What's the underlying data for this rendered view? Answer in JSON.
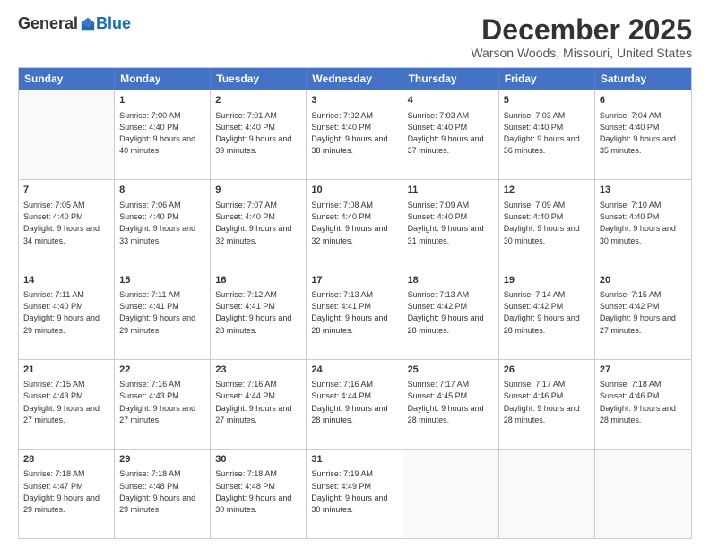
{
  "header": {
    "logo_general": "General",
    "logo_blue": "Blue",
    "month": "December 2025",
    "location": "Warson Woods, Missouri, United States"
  },
  "days_of_week": [
    "Sunday",
    "Monday",
    "Tuesday",
    "Wednesday",
    "Thursday",
    "Friday",
    "Saturday"
  ],
  "rows": [
    [
      {
        "day": "",
        "empty": true
      },
      {
        "day": "1",
        "rise": "7:00 AM",
        "set": "4:40 PM",
        "hours": "9 hours and 40 minutes."
      },
      {
        "day": "2",
        "rise": "7:01 AM",
        "set": "4:40 PM",
        "hours": "9 hours and 39 minutes."
      },
      {
        "day": "3",
        "rise": "7:02 AM",
        "set": "4:40 PM",
        "hours": "9 hours and 38 minutes."
      },
      {
        "day": "4",
        "rise": "7:03 AM",
        "set": "4:40 PM",
        "hours": "9 hours and 37 minutes."
      },
      {
        "day": "5",
        "rise": "7:03 AM",
        "set": "4:40 PM",
        "hours": "9 hours and 36 minutes."
      },
      {
        "day": "6",
        "rise": "7:04 AM",
        "set": "4:40 PM",
        "hours": "9 hours and 35 minutes."
      }
    ],
    [
      {
        "day": "7",
        "rise": "7:05 AM",
        "set": "4:40 PM",
        "hours": "9 hours and 34 minutes."
      },
      {
        "day": "8",
        "rise": "7:06 AM",
        "set": "4:40 PM",
        "hours": "9 hours and 33 minutes."
      },
      {
        "day": "9",
        "rise": "7:07 AM",
        "set": "4:40 PM",
        "hours": "9 hours and 32 minutes."
      },
      {
        "day": "10",
        "rise": "7:08 AM",
        "set": "4:40 PM",
        "hours": "9 hours and 32 minutes."
      },
      {
        "day": "11",
        "rise": "7:09 AM",
        "set": "4:40 PM",
        "hours": "9 hours and 31 minutes."
      },
      {
        "day": "12",
        "rise": "7:09 AM",
        "set": "4:40 PM",
        "hours": "9 hours and 30 minutes."
      },
      {
        "day": "13",
        "rise": "7:10 AM",
        "set": "4:40 PM",
        "hours": "9 hours and 30 minutes."
      }
    ],
    [
      {
        "day": "14",
        "rise": "7:11 AM",
        "set": "4:40 PM",
        "hours": "9 hours and 29 minutes."
      },
      {
        "day": "15",
        "rise": "7:11 AM",
        "set": "4:41 PM",
        "hours": "9 hours and 29 minutes."
      },
      {
        "day": "16",
        "rise": "7:12 AM",
        "set": "4:41 PM",
        "hours": "9 hours and 28 minutes."
      },
      {
        "day": "17",
        "rise": "7:13 AM",
        "set": "4:41 PM",
        "hours": "9 hours and 28 minutes."
      },
      {
        "day": "18",
        "rise": "7:13 AM",
        "set": "4:42 PM",
        "hours": "9 hours and 28 minutes."
      },
      {
        "day": "19",
        "rise": "7:14 AM",
        "set": "4:42 PM",
        "hours": "9 hours and 28 minutes."
      },
      {
        "day": "20",
        "rise": "7:15 AM",
        "set": "4:42 PM",
        "hours": "9 hours and 27 minutes."
      }
    ],
    [
      {
        "day": "21",
        "rise": "7:15 AM",
        "set": "4:43 PM",
        "hours": "9 hours and 27 minutes."
      },
      {
        "day": "22",
        "rise": "7:16 AM",
        "set": "4:43 PM",
        "hours": "9 hours and 27 minutes."
      },
      {
        "day": "23",
        "rise": "7:16 AM",
        "set": "4:44 PM",
        "hours": "9 hours and 27 minutes."
      },
      {
        "day": "24",
        "rise": "7:16 AM",
        "set": "4:44 PM",
        "hours": "9 hours and 28 minutes."
      },
      {
        "day": "25",
        "rise": "7:17 AM",
        "set": "4:45 PM",
        "hours": "9 hours and 28 minutes."
      },
      {
        "day": "26",
        "rise": "7:17 AM",
        "set": "4:46 PM",
        "hours": "9 hours and 28 minutes."
      },
      {
        "day": "27",
        "rise": "7:18 AM",
        "set": "4:46 PM",
        "hours": "9 hours and 28 minutes."
      }
    ],
    [
      {
        "day": "28",
        "rise": "7:18 AM",
        "set": "4:47 PM",
        "hours": "9 hours and 29 minutes."
      },
      {
        "day": "29",
        "rise": "7:18 AM",
        "set": "4:48 PM",
        "hours": "9 hours and 29 minutes."
      },
      {
        "day": "30",
        "rise": "7:18 AM",
        "set": "4:48 PM",
        "hours": "9 hours and 30 minutes."
      },
      {
        "day": "31",
        "rise": "7:19 AM",
        "set": "4:49 PM",
        "hours": "9 hours and 30 minutes."
      },
      {
        "day": "",
        "empty": true
      },
      {
        "day": "",
        "empty": true
      },
      {
        "day": "",
        "empty": true
      }
    ]
  ]
}
